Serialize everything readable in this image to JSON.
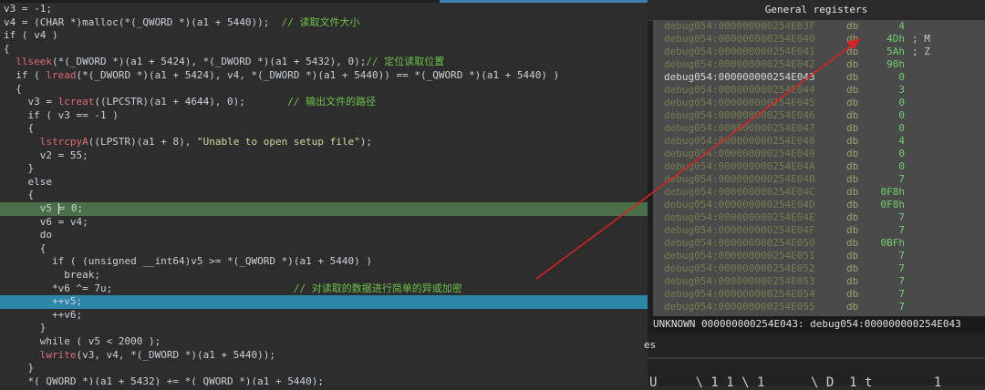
{
  "code_lines": [
    {
      "parts": [
        {
          "t": "v3 = -1;",
          "c": ""
        }
      ]
    },
    {
      "parts": [
        {
          "t": "v4 = (CHAR *)malloc(*(_QWORD *)(a1 + 5440));  ",
          "c": ""
        },
        {
          "t": "// 读取文件大小",
          "c": "cmt"
        }
      ]
    },
    {
      "parts": [
        {
          "t": "if ( v4 )",
          "c": ""
        }
      ]
    },
    {
      "parts": [
        {
          "t": "{",
          "c": ""
        }
      ]
    },
    {
      "parts": [
        {
          "t": "  ",
          "c": ""
        },
        {
          "t": "llseek",
          "c": "fn"
        },
        {
          "t": "(*(_DWORD *)(a1 + 5424), *(_DWORD *)(a1 + 5432), 0);",
          "c": ""
        },
        {
          "t": "// 定位读取位置",
          "c": "cmt"
        }
      ]
    },
    {
      "parts": [
        {
          "t": "  if ( ",
          "c": ""
        },
        {
          "t": "lread",
          "c": "fn"
        },
        {
          "t": "(*(_DWORD *)(a1 + 5424), v4, *(_DWORD *)(a1 + 5440)) == *(_QWORD *)(a1 + 5440) )",
          "c": ""
        }
      ]
    },
    {
      "parts": [
        {
          "t": "  {",
          "c": ""
        }
      ]
    },
    {
      "parts": [
        {
          "t": "    v3 = ",
          "c": ""
        },
        {
          "t": "lcreat",
          "c": "fn"
        },
        {
          "t": "((LPCSTR)(a1 + 4644), 0);       ",
          "c": ""
        },
        {
          "t": "// 输出文件的路径",
          "c": "cmt"
        }
      ]
    },
    {
      "parts": [
        {
          "t": "    if ( v3 == -1 )",
          "c": ""
        }
      ]
    },
    {
      "parts": [
        {
          "t": "    {",
          "c": ""
        }
      ]
    },
    {
      "parts": [
        {
          "t": "      ",
          "c": ""
        },
        {
          "t": "lstrcpyA",
          "c": "fn"
        },
        {
          "t": "((LPSTR)(a1 + 8), ",
          "c": ""
        },
        {
          "t": "\"Unable to open setup file\"",
          "c": "str"
        },
        {
          "t": ");",
          "c": ""
        }
      ]
    },
    {
      "parts": [
        {
          "t": "      v2 = 55;",
          "c": ""
        }
      ]
    },
    {
      "parts": [
        {
          "t": "    }",
          "c": ""
        }
      ]
    },
    {
      "parts": [
        {
          "t": "    else",
          "c": ""
        }
      ]
    },
    {
      "parts": [
        {
          "t": "    {",
          "c": ""
        }
      ]
    },
    {
      "parts": [
        {
          "t": "      v5 ",
          "c": ""
        },
        {
          "t": "|",
          "c": "cursor"
        },
        {
          "t": "= 0;",
          "c": ""
        }
      ],
      "hl": "green"
    },
    {
      "parts": [
        {
          "t": "      v6 = v4;",
          "c": ""
        }
      ]
    },
    {
      "parts": [
        {
          "t": "      do",
          "c": ""
        }
      ]
    },
    {
      "parts": [
        {
          "t": "      {",
          "c": ""
        }
      ]
    },
    {
      "parts": [
        {
          "t": "        if ( (unsigned __int64)v5 >= *(_QWORD *)(a1 + 5440) )",
          "c": ""
        }
      ]
    },
    {
      "parts": [
        {
          "t": "          break;",
          "c": ""
        }
      ]
    },
    {
      "parts": [
        {
          "t": "        *v6 ^= 7u;                              ",
          "c": ""
        },
        {
          "t": "// 对读取的数据进行简单的异或加密",
          "c": "cmt"
        }
      ]
    },
    {
      "parts": [
        {
          "t": "        ++v5;",
          "c": ""
        }
      ],
      "hl": "blue"
    },
    {
      "parts": [
        {
          "t": "        ++v6;",
          "c": ""
        }
      ]
    },
    {
      "parts": [
        {
          "t": "      }",
          "c": ""
        }
      ]
    },
    {
      "parts": [
        {
          "t": "      while ( v5 < 2000 );",
          "c": ""
        }
      ]
    },
    {
      "parts": [
        {
          "t": "      ",
          "c": ""
        },
        {
          "t": "lwrite",
          "c": "fn"
        },
        {
          "t": "(v3, v4, *(_DWORD *)(a1 + 5440));",
          "c": ""
        }
      ]
    },
    {
      "parts": [
        {
          "t": "    }",
          "c": ""
        }
      ]
    },
    {
      "parts": [
        {
          "t": "    *(_QWORD *)(a1 + 5432) += *(_QWORD *)(a1 + 5440);",
          "c": ""
        }
      ]
    },
    {
      "parts": [
        {
          "t": "  }",
          "c": ""
        }
      ]
    }
  ],
  "registers_panel": {
    "title": "General registers",
    "rows": [
      {
        "addr": "debug054:000000000254E03F",
        "op": "db",
        "val": "4",
        "cmt": ""
      },
      {
        "addr": "debug054:000000000254E040",
        "op": "db",
        "val": "4Dh",
        "cmt": "; M"
      },
      {
        "addr": "debug054:000000000254E041",
        "op": "db",
        "val": "5Ah",
        "cmt": "; Z"
      },
      {
        "addr": "debug054:000000000254E042",
        "op": "db",
        "val": "90h",
        "cmt": ""
      },
      {
        "addr": "debug054:000000000254E043",
        "op": "db",
        "val": "0",
        "cmt": "",
        "current": true
      },
      {
        "addr": "debug054:000000000254E044",
        "op": "db",
        "val": "3",
        "cmt": ""
      },
      {
        "addr": "debug054:000000000254E045",
        "op": "db",
        "val": "0",
        "cmt": ""
      },
      {
        "addr": "debug054:000000000254E046",
        "op": "db",
        "val": "0",
        "cmt": ""
      },
      {
        "addr": "debug054:000000000254E047",
        "op": "db",
        "val": "0",
        "cmt": ""
      },
      {
        "addr": "debug054:000000000254E048",
        "op": "db",
        "val": "4",
        "cmt": ""
      },
      {
        "addr": "debug054:000000000254E049",
        "op": "db",
        "val": "0",
        "cmt": ""
      },
      {
        "addr": "debug054:000000000254E04A",
        "op": "db",
        "val": "0",
        "cmt": ""
      },
      {
        "addr": "debug054:000000000254E04B",
        "op": "db",
        "val": "7",
        "cmt": ""
      },
      {
        "addr": "debug054:000000000254E04C",
        "op": "db",
        "val": "0F8h",
        "cmt": ""
      },
      {
        "addr": "debug054:000000000254E04D",
        "op": "db",
        "val": "0F8h",
        "cmt": ""
      },
      {
        "addr": "debug054:000000000254E04E",
        "op": "db",
        "val": "7",
        "cmt": ""
      },
      {
        "addr": "debug054:000000000254E04F",
        "op": "db",
        "val": "7",
        "cmt": ""
      },
      {
        "addr": "debug054:000000000254E050",
        "op": "db",
        "val": "0BFh",
        "cmt": ""
      },
      {
        "addr": "debug054:000000000254E051",
        "op": "db",
        "val": "7",
        "cmt": ""
      },
      {
        "addr": "debug054:000000000254E052",
        "op": "db",
        "val": "7",
        "cmt": ""
      },
      {
        "addr": "debug054:000000000254E053",
        "op": "db",
        "val": "7",
        "cmt": ""
      },
      {
        "addr": "debug054:000000000254E054",
        "op": "db",
        "val": "7",
        "cmt": ""
      },
      {
        "addr": "debug054:000000000254E055",
        "op": "db",
        "val": "7",
        "cmt": ""
      }
    ],
    "status_line": "UNKNOWN 000000000254E043: debug054:000000000254E043",
    "tab_fragment": "es",
    "command_fragment": "U     \\ 1 1 \\ 1      \\ D  1 t        1"
  },
  "colors": {
    "highlight_green": "#4b6f48",
    "highlight_blue": "#2e86a8",
    "comment": "#6cc24a",
    "arrow": "#e02020"
  }
}
